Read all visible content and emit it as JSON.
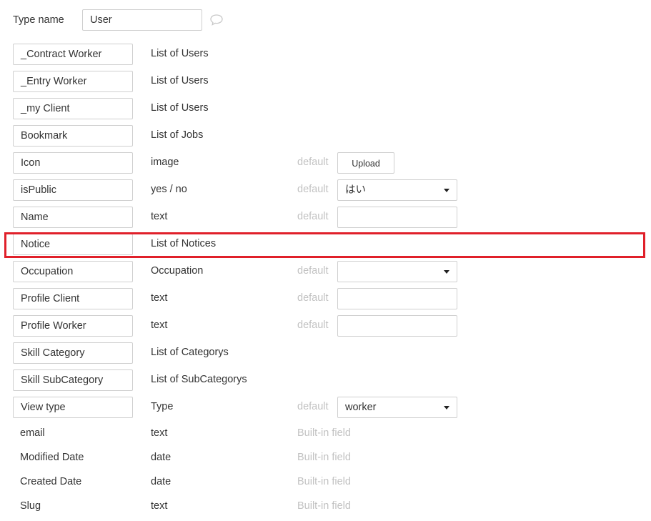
{
  "header": {
    "label": "Type name",
    "type_name": "User"
  },
  "icons": {
    "comment": "speech-bubble-icon"
  },
  "colors": {
    "highlight": "#e0202a",
    "muted_text": "#c2c2c2",
    "border": "#cfcfcf"
  },
  "default_label": "default",
  "builtin_label": "Built-in field",
  "fields": [
    {
      "name": "_Contract Worker",
      "type": "List of Users"
    },
    {
      "name": "_Entry Worker",
      "type": "List of Users"
    },
    {
      "name": "_my Client",
      "type": "List of Users"
    },
    {
      "name": "Bookmark",
      "type": "List of Jobs"
    },
    {
      "name": "Icon",
      "type": "image",
      "default_kind": "upload",
      "upload_label": "Upload"
    },
    {
      "name": "isPublic",
      "type": "yes / no",
      "default_kind": "select",
      "default_value": "はい"
    },
    {
      "name": "Name",
      "type": "text",
      "default_kind": "input",
      "default_value": ""
    },
    {
      "name": "Notice",
      "type": "List of Notices",
      "highlighted": true
    },
    {
      "name": "Occupation",
      "type": "Occupation",
      "default_kind": "select",
      "default_value": ""
    },
    {
      "name": "Profile Client",
      "type": "text",
      "default_kind": "input",
      "default_value": ""
    },
    {
      "name": "Profile Worker",
      "type": "text",
      "default_kind": "input",
      "default_value": ""
    },
    {
      "name": "Skill Category",
      "type": "List of Categorys"
    },
    {
      "name": "Skill SubCategory",
      "type": "List of SubCategorys"
    },
    {
      "name": "View type",
      "type": "Type",
      "default_kind": "select",
      "default_value": "worker"
    }
  ],
  "builtin_fields": [
    {
      "name": "email",
      "type": "text"
    },
    {
      "name": "Modified Date",
      "type": "date"
    },
    {
      "name": "Created Date",
      "type": "date"
    },
    {
      "name": "Slug",
      "type": "text"
    }
  ]
}
